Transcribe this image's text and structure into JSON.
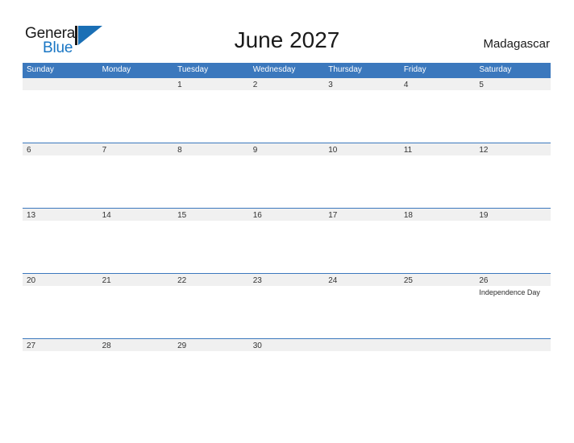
{
  "brand": {
    "name_part1": "General",
    "name_part2": "Blue",
    "logo_icon": "sail-flag-icon",
    "accent_color": "#1976c4"
  },
  "header": {
    "title": "June 2027",
    "country": "Madagascar"
  },
  "theme": {
    "header_blue": "#3b78bd",
    "band_gray": "#f0f0f0",
    "text_dark": "#333333"
  },
  "calendar": {
    "weekdays": [
      "Sunday",
      "Monday",
      "Tuesday",
      "Wednesday",
      "Thursday",
      "Friday",
      "Saturday"
    ],
    "weeks": [
      [
        {
          "day": "",
          "events": []
        },
        {
          "day": "",
          "events": []
        },
        {
          "day": "1",
          "events": []
        },
        {
          "day": "2",
          "events": []
        },
        {
          "day": "3",
          "events": []
        },
        {
          "day": "4",
          "events": []
        },
        {
          "day": "5",
          "events": []
        }
      ],
      [
        {
          "day": "6",
          "events": []
        },
        {
          "day": "7",
          "events": []
        },
        {
          "day": "8",
          "events": []
        },
        {
          "day": "9",
          "events": []
        },
        {
          "day": "10",
          "events": []
        },
        {
          "day": "11",
          "events": []
        },
        {
          "day": "12",
          "events": []
        }
      ],
      [
        {
          "day": "13",
          "events": []
        },
        {
          "day": "14",
          "events": []
        },
        {
          "day": "15",
          "events": []
        },
        {
          "day": "16",
          "events": []
        },
        {
          "day": "17",
          "events": []
        },
        {
          "day": "18",
          "events": []
        },
        {
          "day": "19",
          "events": []
        }
      ],
      [
        {
          "day": "20",
          "events": []
        },
        {
          "day": "21",
          "events": []
        },
        {
          "day": "22",
          "events": []
        },
        {
          "day": "23",
          "events": []
        },
        {
          "day": "24",
          "events": []
        },
        {
          "day": "25",
          "events": []
        },
        {
          "day": "26",
          "events": [
            "Independence Day"
          ]
        }
      ],
      [
        {
          "day": "27",
          "events": []
        },
        {
          "day": "28",
          "events": []
        },
        {
          "day": "29",
          "events": []
        },
        {
          "day": "30",
          "events": []
        },
        {
          "day": "",
          "events": []
        },
        {
          "day": "",
          "events": []
        },
        {
          "day": "",
          "events": []
        }
      ]
    ]
  }
}
